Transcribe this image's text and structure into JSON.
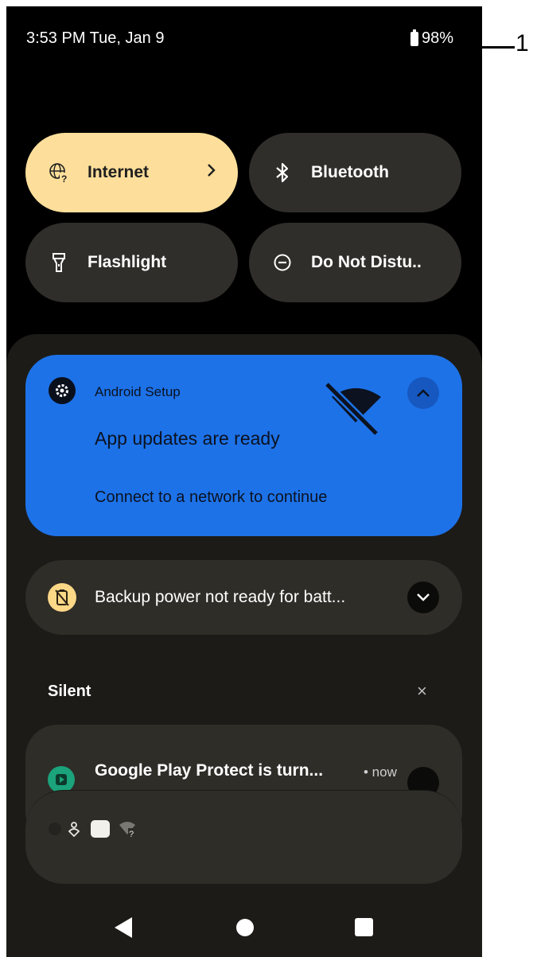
{
  "status_bar": {
    "time": "3:53 PM Tue, Jan 9",
    "battery": "98%"
  },
  "callout": {
    "label": "1"
  },
  "quick_tiles": [
    {
      "label": "Internet",
      "icon": "globe-question-icon",
      "active": true
    },
    {
      "label": "Bluetooth",
      "icon": "bluetooth-icon",
      "active": false
    },
    {
      "label": "Flashlight",
      "icon": "flashlight-icon",
      "active": false
    },
    {
      "label": "Do Not Distu..",
      "icon": "do-not-disturb-icon",
      "active": false
    }
  ],
  "notifications": {
    "setup": {
      "app": "Android Setup",
      "title": "App updates are ready",
      "body": "Connect to a network to continue"
    },
    "backup": {
      "text": "Backup power not ready for batt..."
    },
    "silent_header": {
      "label": "Silent",
      "clear_icon": "×"
    },
    "play_protect": {
      "title": "Google Play Protect is turn...",
      "time": "• now"
    }
  },
  "colors": {
    "internet_tile": "#fddf9b",
    "tile_bg": "#302e2a",
    "setup_card": "#1d72e8",
    "shade_bg": "#1c1b17",
    "play_protect_green": "#1ba37b",
    "backup_icon_bg": "#fcd887"
  }
}
